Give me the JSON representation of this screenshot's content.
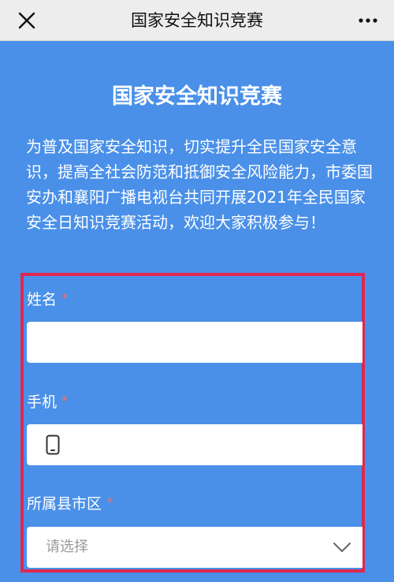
{
  "topbar": {
    "title": "国家安全知识竞赛"
  },
  "icons": {
    "close": "close-icon",
    "more": "more-icon",
    "phone": "mobile-phone-icon",
    "chevron": "chevron-down-icon"
  },
  "page": {
    "title": "国家安全知识竞赛",
    "intro": "为普及国家安全知识，切实提升全民国家安全意识，提高全社会防范和抵御安全风险能力，市委国安办和襄阳广播电视台共同开展2021年全民国家安全日知识竞赛活动，欢迎大家积极参与！"
  },
  "form": {
    "name_label": "姓名",
    "name_value": "",
    "phone_label": "手机",
    "phone_value": "",
    "district_label": "所属县市区",
    "district_placeholder": "请选择",
    "required_mark": "*"
  },
  "colors": {
    "background": "#4a90e8",
    "highlight_frame": "#e0274f",
    "required": "#f26d6d",
    "topbar": "#ededed"
  }
}
